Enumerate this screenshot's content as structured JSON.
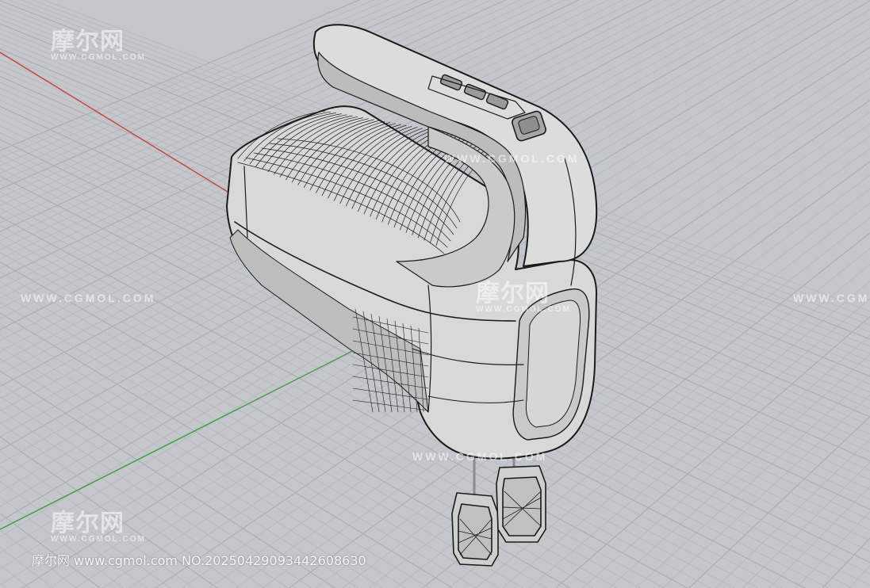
{
  "viewport": {
    "background": "#c3c6ca",
    "grid_minor_color": "#b4b6ba",
    "grid_major_color": "#a8acb0",
    "x_axis_color": "#c8413a",
    "y_axis_color": "#3f9e3f",
    "model_fill": "#d9d9d9",
    "model_shadow": "#9a9a9a",
    "wire_color": "#1a1a1a"
  },
  "watermarks": {
    "logo_cn": "摩尔网",
    "logo_en": "WWW.CGMOL.COM",
    "url": "WWW.CGMOL.COM"
  },
  "footer": {
    "credit": "摩尔网 www.cgmol.com NO.20250429093442608630"
  }
}
